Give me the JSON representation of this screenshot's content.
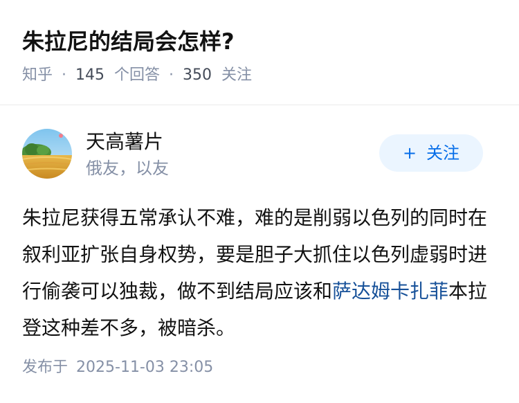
{
  "question": {
    "title": "朱拉尼的结局会怎样?",
    "meta": {
      "source": "知乎",
      "answer_count": "145",
      "answer_label": "个回答",
      "follow_count": "350",
      "follow_label": "关注"
    }
  },
  "answer": {
    "author": {
      "name": "天高薯片",
      "bio": "俄友，以友"
    },
    "follow_button": {
      "icon": "+",
      "label": "关注"
    },
    "content": {
      "text_before_link": "朱拉尼获得五常承认不难，难的是削弱以色列的同时在叙利亚扩张自身权势，要是胆子大抓住以色列虚弱时进行偷袭可以独裁，做不到结局应该和",
      "link_text": "萨达姆卡扎菲",
      "text_after_link": "本拉登这种差不多，被暗杀。"
    },
    "published": {
      "label": "发布于",
      "time": "2025-11-03 23:05"
    }
  },
  "colors": {
    "link": "#175199",
    "accent": "#056de8",
    "follow_button_bg": "#ebf5ff",
    "meta_gray": "#8590a6"
  }
}
